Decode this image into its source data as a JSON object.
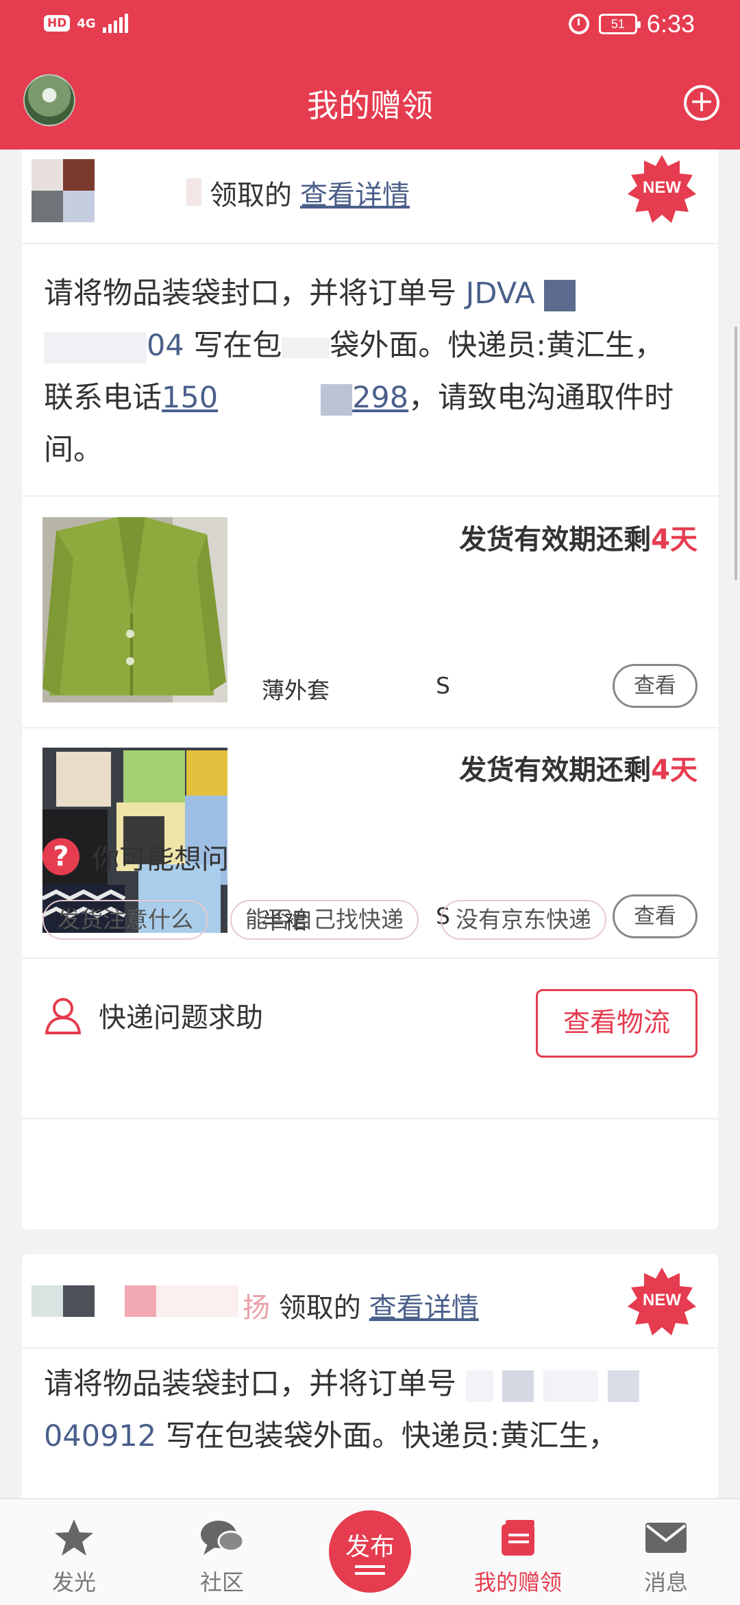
{
  "status_bar": {
    "hd": "HD",
    "network": "4G",
    "battery": "51",
    "time": "6:33"
  },
  "header": {
    "title": "我的赠领"
  },
  "orders": [
    {
      "claimer_suffix": "领取的",
      "detail_link": "查看详情",
      "badge": "NEW",
      "instruction_part1": "请将物品装袋封口，并将订单号",
      "order_no_visible": "JDVA",
      "order_no_tail": "04",
      "instruction_part2": "写在包",
      "instruction_part3": "袋外面。快递员:黄汇生，",
      "instruction_part4": "联系电话",
      "phone_head": "150",
      "phone_tail": "298",
      "instruction_part5": "，请致电沟通取件时间。",
      "items": [
        {
          "validity_prefix": "发货有效期还剩",
          "validity_days": "4天",
          "name": "薄外套",
          "size": "S",
          "view_label": "查看"
        },
        {
          "validity_prefix": "发货有效期还剩",
          "validity_days": "4天",
          "name": "半裙",
          "size": "S",
          "view_label": "查看"
        }
      ],
      "faq_title": "你可能想问",
      "faq_chips": [
        "发货注意什么",
        "能否自己找快递",
        "没有京东快递"
      ],
      "help_label": "快递问题求助",
      "logistics_label": "查看物流"
    },
    {
      "claimer_name_visible": "扬",
      "claimer_suffix": "领取的",
      "detail_link": "查看详情",
      "badge": "NEW",
      "instruction_part1": "请将物品装袋封口，并将订单号",
      "order_no_tail": "040912",
      "instruction_part2": "写在包装袋外面。快递员:黄汇生，"
    }
  ],
  "bottom_nav": [
    {
      "label": "发光",
      "icon": "star-icon"
    },
    {
      "label": "社区",
      "icon": "chat-icon"
    },
    {
      "label": "发布",
      "icon": "publish-button"
    },
    {
      "label": "我的赠领",
      "icon": "gift-book-icon"
    },
    {
      "label": "消息",
      "icon": "mail-icon"
    }
  ],
  "colors": {
    "brand": "#e63c4f",
    "link": "#4a5f8a"
  }
}
